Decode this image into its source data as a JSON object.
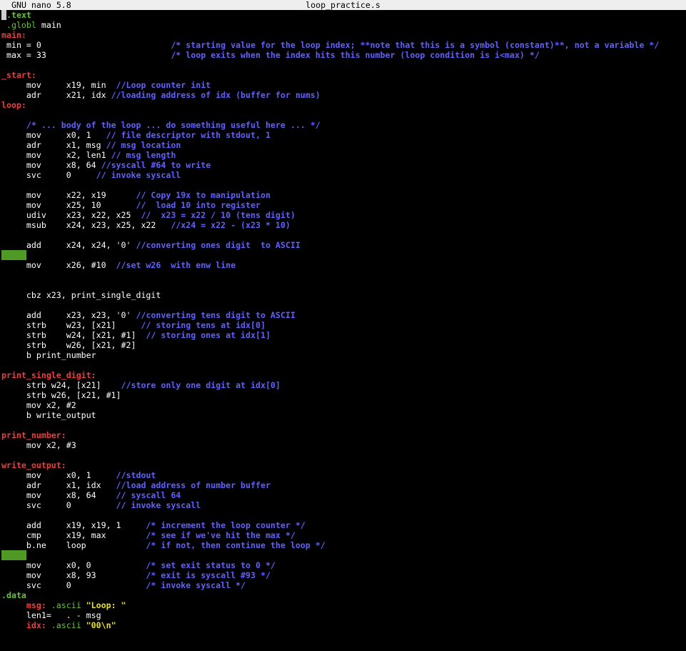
{
  "titlebar": {
    "app_name": "GNU nano 5.8",
    "file_name": "loop_practice.s"
  },
  "colors": {
    "label": "#ef3c3c",
    "directive": "#67c23a",
    "comment": "#6060ff",
    "string": "#e8e025",
    "trailing_whitespace_marker": "#4e9a25",
    "background": "#000000",
    "titlebar": "#eeeeee"
  },
  "lines": [
    {
      "cursor": true,
      "segs": [
        {
          "c": "dirb",
          "t": ".text"
        }
      ]
    },
    {
      "segs": [
        {
          "c": "dir",
          "t": " .globl"
        },
        {
          "c": "pl",
          "t": " main"
        }
      ]
    },
    {
      "segs": [
        {
          "c": "lbl",
          "t": "main:"
        }
      ]
    },
    {
      "segs": [
        {
          "c": "pl",
          "t": " min = 0                          "
        },
        {
          "c": "cmt",
          "t": "/* starting value for the loop index; **note that this is a symbol (constant)**, not a variable */"
        }
      ]
    },
    {
      "segs": [
        {
          "c": "pl",
          "t": " max = 33                         "
        },
        {
          "c": "cmt",
          "t": "/* loop exits when the index hits this number (loop condition is i<max) */"
        }
      ]
    },
    {
      "segs": []
    },
    {
      "segs": [
        {
          "c": "lbl",
          "t": "_start:"
        }
      ]
    },
    {
      "segs": [
        {
          "c": "pl",
          "t": "     mov     x19, min  "
        },
        {
          "c": "cmt",
          "t": "//Loop counter init"
        }
      ]
    },
    {
      "segs": [
        {
          "c": "pl",
          "t": "     adr     x21, idx "
        },
        {
          "c": "cmt",
          "t": "//loading address of idx (buffer for nums)"
        }
      ]
    },
    {
      "segs": [
        {
          "c": "lbl",
          "t": "loop:"
        }
      ]
    },
    {
      "segs": []
    },
    {
      "segs": [
        {
          "c": "pl",
          "t": "     "
        },
        {
          "c": "cmt",
          "t": "/* ... body of the loop ... do something useful here ... */"
        }
      ]
    },
    {
      "segs": [
        {
          "c": "pl",
          "t": "     mov     x0, 1   "
        },
        {
          "c": "cmt",
          "t": "// file descriptor with stdout, 1"
        }
      ]
    },
    {
      "segs": [
        {
          "c": "pl",
          "t": "     adr     x1, msg "
        },
        {
          "c": "cmt",
          "t": "// msg location"
        }
      ]
    },
    {
      "segs": [
        {
          "c": "pl",
          "t": "     mov     x2, len1 "
        },
        {
          "c": "cmt",
          "t": "// msg length"
        }
      ]
    },
    {
      "segs": [
        {
          "c": "pl",
          "t": "     mov     x8, 64 "
        },
        {
          "c": "cmt",
          "t": "//syscall #64 to write"
        }
      ]
    },
    {
      "segs": [
        {
          "c": "pl",
          "t": "     svc     0     "
        },
        {
          "c": "cmt",
          "t": "// invoke syscall"
        }
      ]
    },
    {
      "segs": []
    },
    {
      "segs": [
        {
          "c": "pl",
          "t": "     mov     x22, x19      "
        },
        {
          "c": "cmt",
          "t": "// Copy 19x to manipulation"
        }
      ]
    },
    {
      "segs": [
        {
          "c": "pl",
          "t": "     mov     x25, 10       "
        },
        {
          "c": "cmt",
          "t": "//  load 10 into register"
        }
      ]
    },
    {
      "segs": [
        {
          "c": "pl",
          "t": "     udiv    x23, x22, x25  "
        },
        {
          "c": "cmt",
          "t": "//  x23 = x22 / 10 (tens digit)"
        }
      ]
    },
    {
      "segs": [
        {
          "c": "pl",
          "t": "     msub    x24, x23, x25, x22   "
        },
        {
          "c": "cmt",
          "t": "//x24 = x22 - (x23 * 10)"
        }
      ]
    },
    {
      "segs": []
    },
    {
      "segs": [
        {
          "c": "pl",
          "t": "     add     x24, x24, '0' "
        },
        {
          "c": "cmt",
          "t": "//converting ones digit  to ASCII"
        }
      ]
    },
    {
      "mark": true,
      "segs": []
    },
    {
      "segs": [
        {
          "c": "pl",
          "t": "     mov     x26, #10  "
        },
        {
          "c": "cmt",
          "t": "//set w26  with enw line"
        }
      ]
    },
    {
      "segs": []
    },
    {
      "segs": []
    },
    {
      "segs": [
        {
          "c": "pl",
          "t": "     cbz x23, print_single_digit"
        }
      ]
    },
    {
      "segs": []
    },
    {
      "segs": [
        {
          "c": "pl",
          "t": "     add     x23, x23, '0' "
        },
        {
          "c": "cmt",
          "t": "//converting tens digit to ASCII"
        }
      ]
    },
    {
      "segs": [
        {
          "c": "pl",
          "t": "     strb    w23, [x21]     "
        },
        {
          "c": "cmt",
          "t": "// storing tens at idx[0]"
        }
      ]
    },
    {
      "segs": [
        {
          "c": "pl",
          "t": "     strb    w24, [x21, #1]  "
        },
        {
          "c": "cmt",
          "t": "// storing ones at idx[1]"
        }
      ]
    },
    {
      "segs": [
        {
          "c": "pl",
          "t": "     strb    w26, [x21, #2]"
        }
      ]
    },
    {
      "segs": [
        {
          "c": "pl",
          "t": "     b print_number"
        }
      ]
    },
    {
      "segs": []
    },
    {
      "segs": [
        {
          "c": "lbl",
          "t": "print_single_digit:"
        }
      ]
    },
    {
      "segs": [
        {
          "c": "pl",
          "t": "     strb w24, [x21]    "
        },
        {
          "c": "cmt",
          "t": "//store only one digit at idx[0]"
        }
      ]
    },
    {
      "segs": [
        {
          "c": "pl",
          "t": "     strb w26, [x21, #1]"
        }
      ]
    },
    {
      "segs": [
        {
          "c": "pl",
          "t": "     mov x2, #2"
        }
      ]
    },
    {
      "segs": [
        {
          "c": "pl",
          "t": "     b write_output"
        }
      ]
    },
    {
      "segs": []
    },
    {
      "segs": [
        {
          "c": "lbl",
          "t": "print_number:"
        }
      ]
    },
    {
      "segs": [
        {
          "c": "pl",
          "t": "     mov x2, #3"
        }
      ]
    },
    {
      "segs": []
    },
    {
      "segs": [
        {
          "c": "lbl",
          "t": "write_output:"
        }
      ]
    },
    {
      "segs": [
        {
          "c": "pl",
          "t": "     mov     x0, 1     "
        },
        {
          "c": "cmt",
          "t": "//stdout"
        }
      ]
    },
    {
      "segs": [
        {
          "c": "pl",
          "t": "     adr     x1, idx   "
        },
        {
          "c": "cmt",
          "t": "//load address of number buffer"
        }
      ]
    },
    {
      "segs": [
        {
          "c": "pl",
          "t": "     mov     x8, 64    "
        },
        {
          "c": "cmt",
          "t": "// syscall 64"
        }
      ]
    },
    {
      "segs": [
        {
          "c": "pl",
          "t": "     svc     0         "
        },
        {
          "c": "cmt",
          "t": "// invoke syscall"
        }
      ]
    },
    {
      "segs": []
    },
    {
      "segs": [
        {
          "c": "pl",
          "t": "     add     x19, x19, 1     "
        },
        {
          "c": "cmt",
          "t": "/* increment the loop counter */"
        }
      ]
    },
    {
      "segs": [
        {
          "c": "pl",
          "t": "     cmp     x19, max        "
        },
        {
          "c": "cmt",
          "t": "/* see if we've hit the max */"
        }
      ]
    },
    {
      "segs": [
        {
          "c": "pl",
          "t": "     b.ne    loop            "
        },
        {
          "c": "cmt",
          "t": "/* if not, then continue the loop */"
        }
      ]
    },
    {
      "mark": true,
      "segs": []
    },
    {
      "segs": [
        {
          "c": "pl",
          "t": "     mov     x0, 0           "
        },
        {
          "c": "cmt",
          "t": "/* set exit status to 0 */"
        }
      ]
    },
    {
      "segs": [
        {
          "c": "pl",
          "t": "     mov     x8, 93          "
        },
        {
          "c": "cmt",
          "t": "/* exit is syscall #93 */"
        }
      ]
    },
    {
      "segs": [
        {
          "c": "pl",
          "t": "     svc     0               "
        },
        {
          "c": "cmt",
          "t": "/* invoke syscall */"
        }
      ]
    },
    {
      "segs": [
        {
          "c": "dirb",
          "t": ".data"
        }
      ]
    },
    {
      "segs": [
        {
          "c": "pl",
          "t": "     "
        },
        {
          "c": "lbl",
          "t": "msg:"
        },
        {
          "c": "dir",
          "t": " .ascii"
        },
        {
          "c": "str",
          "t": " \"Loop: \""
        }
      ]
    },
    {
      "segs": [
        {
          "c": "pl",
          "t": "     len1=   . - msg"
        }
      ]
    },
    {
      "segs": [
        {
          "c": "pl",
          "t": "     "
        },
        {
          "c": "lbl",
          "t": "idx:"
        },
        {
          "c": "dir",
          "t": " .ascii"
        },
        {
          "c": "str",
          "t": " \"00\\n\""
        }
      ]
    }
  ]
}
